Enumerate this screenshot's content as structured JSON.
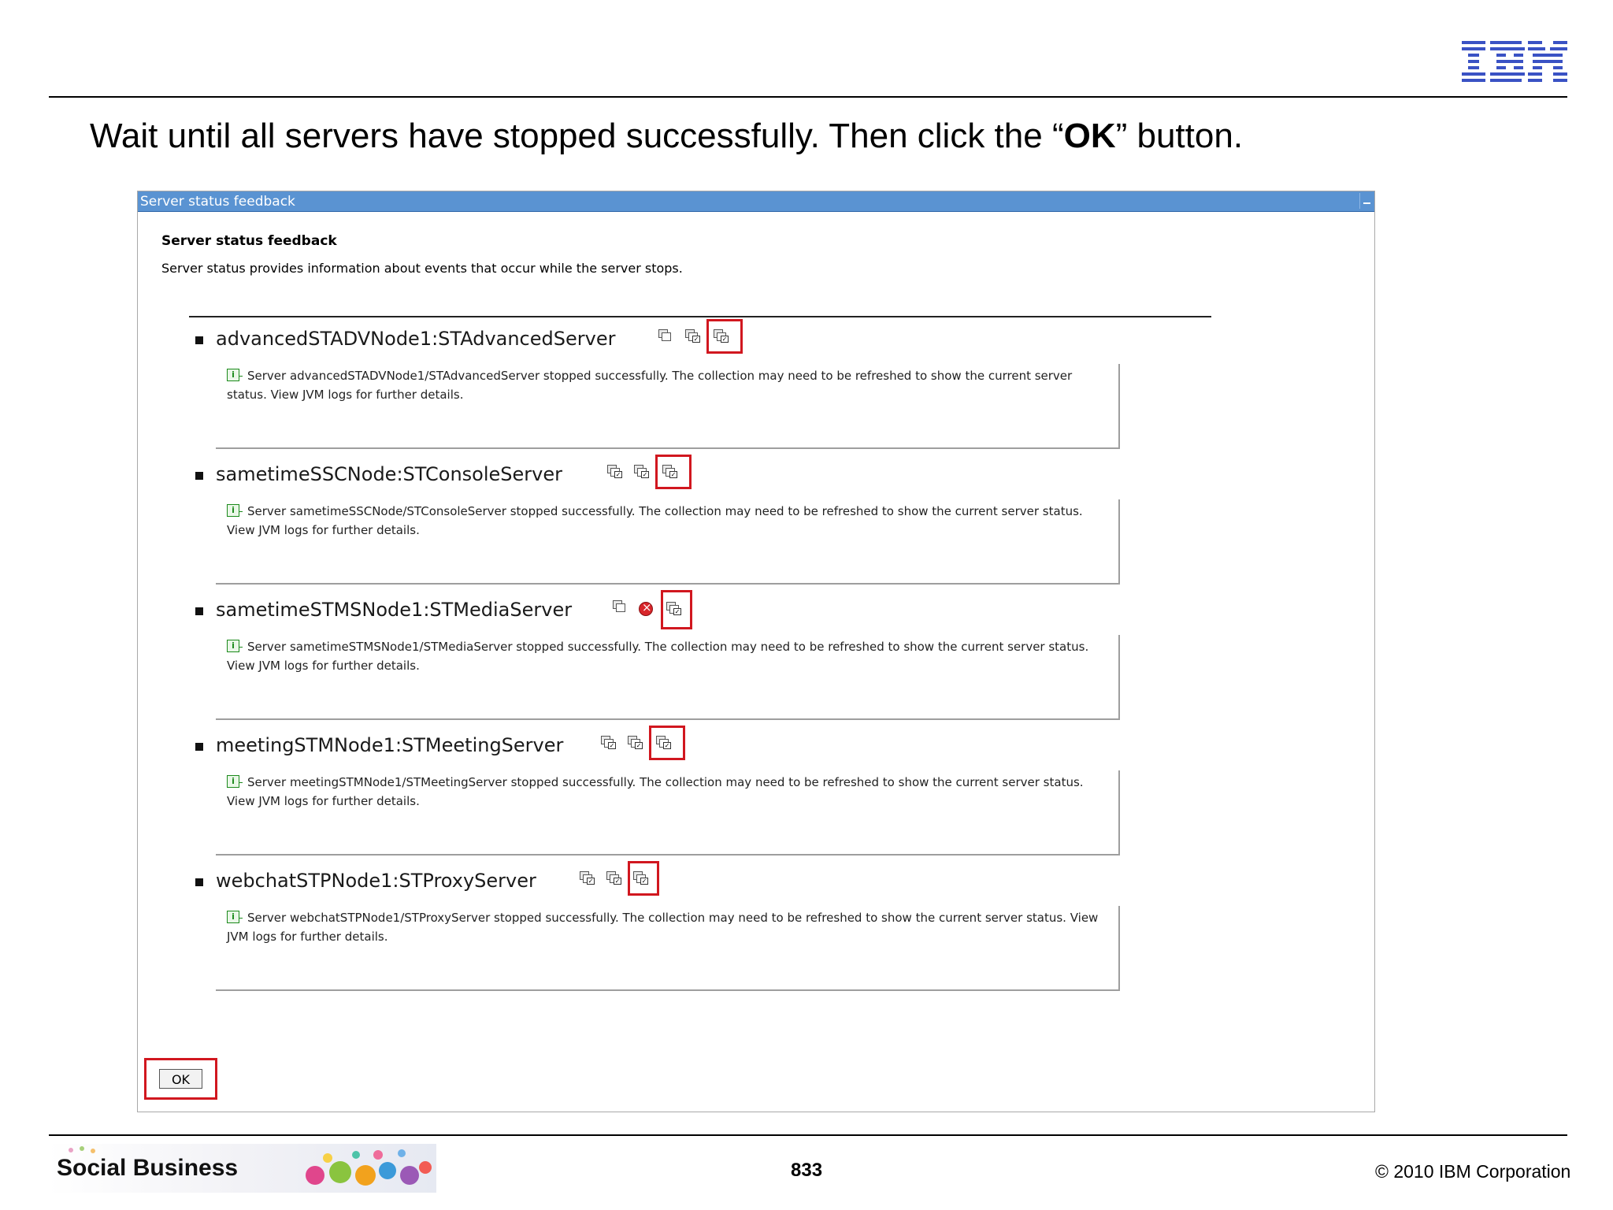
{
  "slide": {
    "instruction_before": "Wait until all servers have stopped successfully. Then click the “",
    "instruction_bold": "OK",
    "instruction_after": "” button.",
    "logo_text": "IBM",
    "footer_title": "Social Business",
    "page_number": "833",
    "copyright": "© 2010 IBM Corporation"
  },
  "dialog": {
    "title": "Server status feedback",
    "heading": "Server status feedback",
    "description": "Server status provides information about events that occur while the server stops.",
    "ok_label": "OK",
    "servers": [
      {
        "name": "advancedSTADVNode1:STAdvancedServer",
        "message": "Server advancedSTADVNode1/STAdvancedServer stopped successfully. The collection may need to be refreshed to show the current server status. View JVM logs for further details."
      },
      {
        "name": "sametimeSSCNode:STConsoleServer",
        "message": "Server sametimeSSCNode/STConsoleServer stopped successfully. The collection may need to be refreshed to show the current server status. View JVM logs for further details."
      },
      {
        "name": "sametimeSTMSNode1:STMediaServer",
        "message": "Server sametimeSTMSNode1/STMediaServer stopped successfully. The collection may need to be refreshed to show the current server status. View JVM logs for further details."
      },
      {
        "name": "meetingSTMNode1:STMeetingServer",
        "message": "Server meetingSTMNode1/STMeetingServer stopped successfully. The collection may need to be refreshed to show the current server status. View JVM logs for further details."
      },
      {
        "name": "webchatSTPNode1:STProxyServer",
        "message": "Server webchatSTPNode1/STProxyServer stopped successfully. The collection may need to be refreshed to show the current server status. View JVM logs for further details."
      }
    ]
  },
  "colors": {
    "titlebar": "#5a93d2",
    "highlight": "#d1171f",
    "ibm_blue": "#3a52c4"
  },
  "icons": {
    "status_icons": [
      "server-status-icon",
      "server-stopping-icon",
      "server-stopped-icon"
    ],
    "media_server_second_icon": "error-icon",
    "info": "info-icon"
  }
}
